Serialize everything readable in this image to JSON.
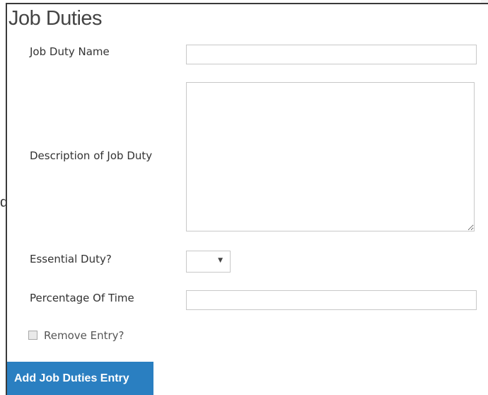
{
  "section": {
    "title": "Job Duties",
    "stray_char": "d"
  },
  "fields": {
    "job_duty_name": {
      "label": "Job Duty Name",
      "value": ""
    },
    "description": {
      "label": "Description of Job Duty",
      "value": ""
    },
    "essential": {
      "label": "Essential Duty?",
      "value": ""
    },
    "percentage": {
      "label": "Percentage Of Time",
      "value": ""
    },
    "remove": {
      "label": "Remove Entry?",
      "checked": false
    }
  },
  "actions": {
    "add_label": "Add Job Duties Entry"
  },
  "colors": {
    "primary_button": "#2a7fc1"
  }
}
